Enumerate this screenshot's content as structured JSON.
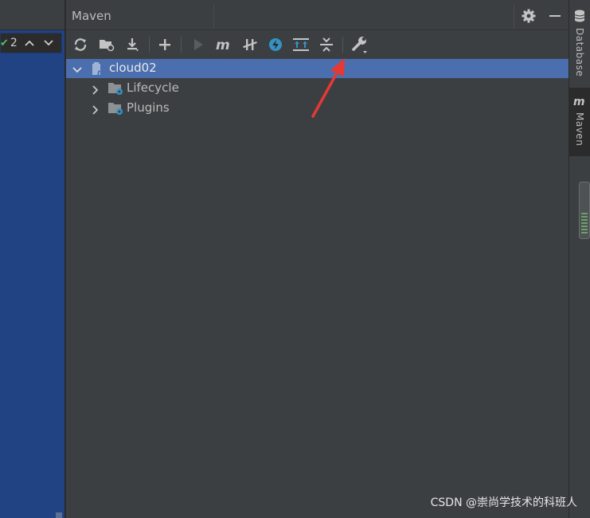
{
  "editor": {
    "inspection_count": "2"
  },
  "panel": {
    "title": "Maven"
  },
  "toolbar": {
    "buttons": [
      "reload-icon",
      "generate-sources-icon",
      "download-icon",
      "add-icon",
      "run-icon",
      "maven-goal-icon",
      "toggle-offline-icon",
      "skip-tests-icon",
      "show-dependencies-icon",
      "collapse-all-icon",
      "settings-wrench-icon"
    ]
  },
  "tree": {
    "root": "cloud02",
    "children": [
      "Lifecycle",
      "Plugins"
    ]
  },
  "right_tabs": {
    "database": "Database",
    "maven": "Maven"
  },
  "watermark": "CSDN @崇尚学技术的科班人",
  "colors": {
    "selected_row": "#4b6eaf",
    "panel_bg": "#3c3f41",
    "editor_bg": "#214283",
    "annotation": "#e53935"
  }
}
